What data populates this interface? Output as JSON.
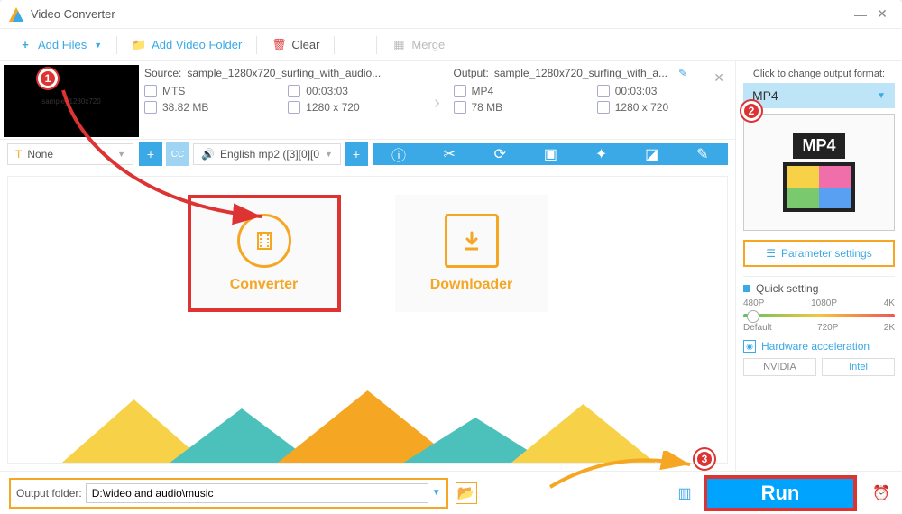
{
  "window": {
    "title": "Video Converter"
  },
  "toolbar": {
    "add_files": "Add Files",
    "add_folder": "Add Video Folder",
    "clear": "Clear",
    "merge": "Merge"
  },
  "file": {
    "source_prefix": "Source:",
    "source_name": "sample_1280x720_surfing_with_audio...",
    "src": {
      "format": "MTS",
      "duration": "00:03:03",
      "size": "38.82 MB",
      "resolution": "1280 x 720"
    },
    "output_prefix": "Output:",
    "output_name": "sample_1280x720_surfing_with_a...",
    "out": {
      "format": "MP4",
      "duration": "00:03:03",
      "size": "78 MB",
      "resolution": "1280 x 720"
    }
  },
  "subs": {
    "selected": "None"
  },
  "audio": {
    "selected": "English mp2 ([3][0][0"
  },
  "modules": {
    "converter": "Converter",
    "downloader": "Downloader"
  },
  "right": {
    "hint": "Click to change output format:",
    "format_label": "MP4",
    "param_btn": "Parameter settings",
    "quick": {
      "title": "Quick setting",
      "p1": "480P",
      "p2": "1080P",
      "p3": "4K",
      "d1": "Default",
      "d2": "720P",
      "d3": "2K"
    },
    "hw": "Hardware acceleration",
    "gpu_nvidia": "NVIDIA",
    "gpu_intel": "Intel"
  },
  "footer": {
    "label": "Output folder:",
    "path": "D:\\video and audio\\music",
    "run": "Run"
  },
  "annotations": {
    "b1": "1",
    "b2": "2",
    "b3": "3"
  }
}
